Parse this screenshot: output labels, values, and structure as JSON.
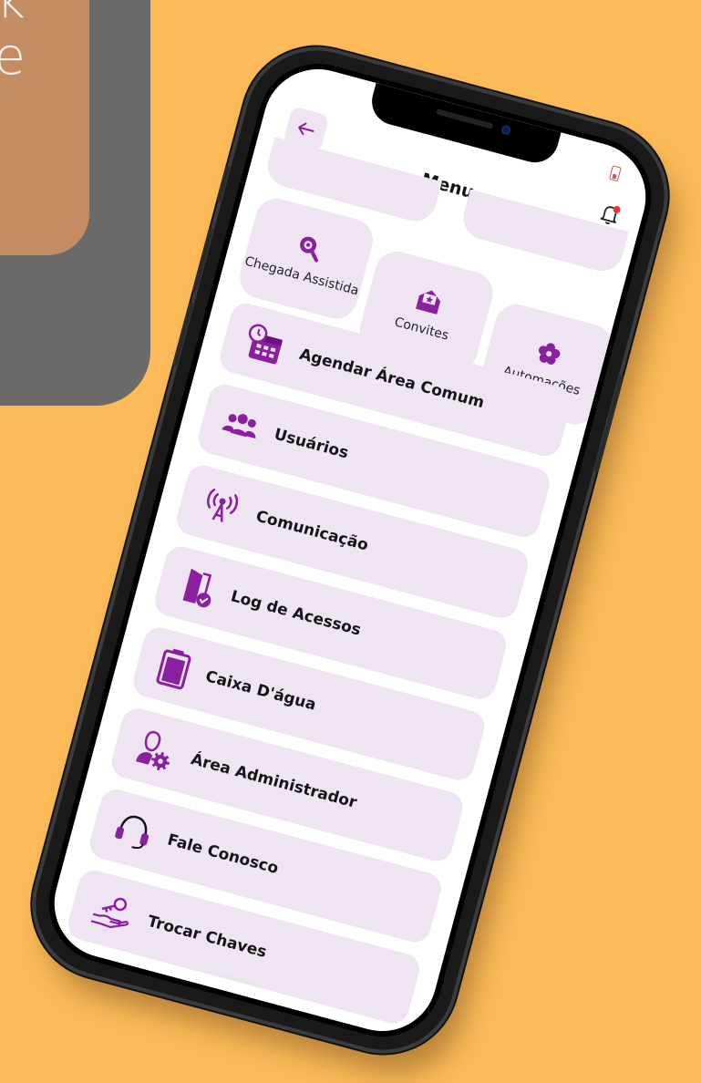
{
  "background": {
    "color": "#fcbb58",
    "promo_lines": [
      "k",
      "e"
    ]
  },
  "colors": {
    "accent": "#8a1fa0",
    "tile_bg": "#efe4f1",
    "notification_dot": "#e53935"
  },
  "header": {
    "title": "Menu",
    "back_icon": "arrow-left-icon",
    "bell_icon": "bell-icon"
  },
  "tiles": [
    {
      "label": "Chegada Assistida",
      "icon": "search-icon"
    },
    {
      "label": "Convites",
      "icon": "envelope-icon"
    },
    {
      "label": "Automações",
      "icon": "flower-icon"
    }
  ],
  "menu": [
    {
      "label": "Agendar Área Comum",
      "icon": "calendar-clock-icon"
    },
    {
      "label": "Usuários",
      "icon": "users-icon"
    },
    {
      "label": "Comunicação",
      "icon": "antenna-icon"
    },
    {
      "label": "Log de Acessos",
      "icon": "door-check-icon"
    },
    {
      "label": "Caixa D'água",
      "icon": "water-tank-icon"
    },
    {
      "label": "Área Administrador",
      "icon": "admin-gear-icon"
    },
    {
      "label": "Fale Conosco",
      "icon": "headset-icon"
    },
    {
      "label": "Trocar Chaves",
      "icon": "key-hand-icon"
    }
  ]
}
